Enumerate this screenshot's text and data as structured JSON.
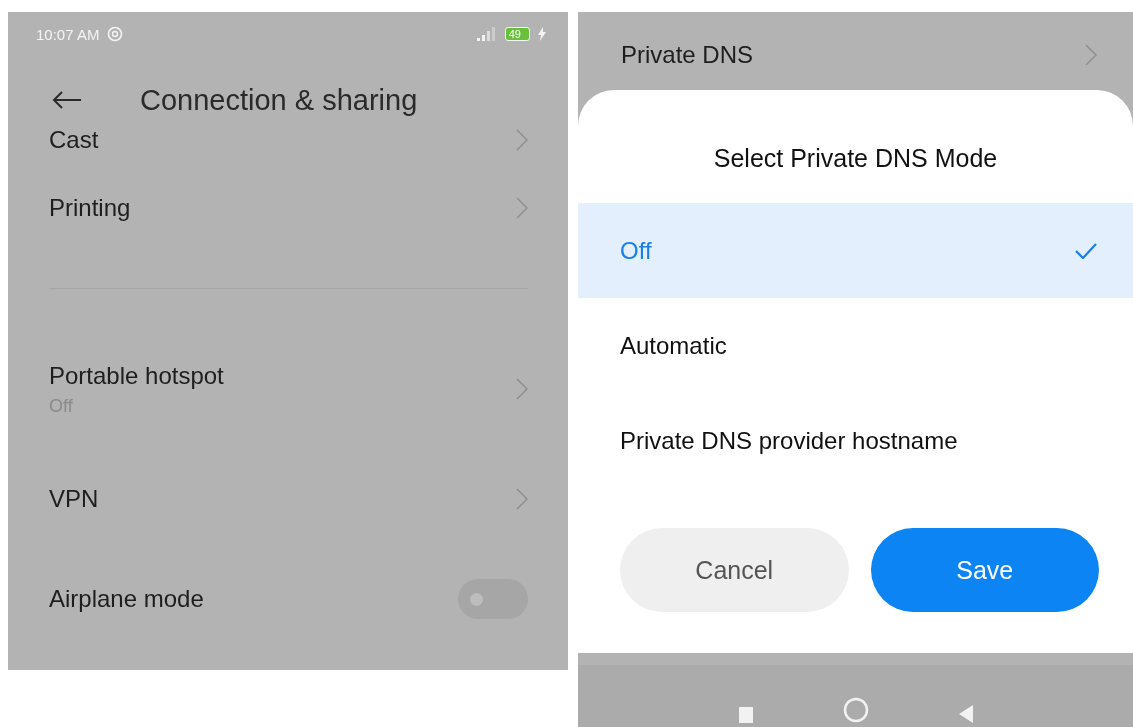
{
  "settings_screen": {
    "status_bar": {
      "time": "10:07 AM",
      "battery": "49"
    },
    "title": "Connection & sharing",
    "items": [
      {
        "kind": "link",
        "label": "Cast"
      },
      {
        "kind": "link",
        "label": "Printing"
      },
      {
        "kind": "divider"
      },
      {
        "kind": "link",
        "label": "Portable hotspot",
        "subtitle": "Off"
      },
      {
        "kind": "link",
        "label": "VPN"
      },
      {
        "kind": "toggle",
        "label": "Airplane mode",
        "on": false
      }
    ]
  },
  "dns_screen": {
    "background_item": "Private DNS",
    "dialog": {
      "title": "Select Private DNS Mode",
      "options": [
        {
          "label": "Off",
          "selected": true
        },
        {
          "label": "Automatic",
          "selected": false
        },
        {
          "label": "Private DNS provider hostname",
          "selected": false
        }
      ],
      "buttons": [
        {
          "kind": "secondary",
          "label": "Cancel"
        },
        {
          "kind": "primary",
          "label": "Save"
        }
      ]
    }
  }
}
